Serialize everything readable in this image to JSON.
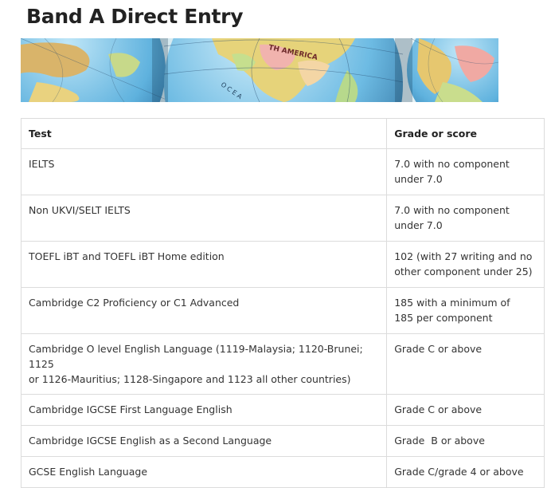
{
  "page": {
    "title": "Band A Direct Entry",
    "banner_label": "TH AMERICA",
    "banner_ocean_label": "O C E A"
  },
  "table": {
    "headers": {
      "test": "Test",
      "grade": "Grade or score"
    },
    "rows": [
      {
        "test": "IELTS",
        "grade": "7.0 with no component\nunder 7.0"
      },
      {
        "test": "Non UKVI/SELT IELTS",
        "grade": "7.0 with no component\nunder 7.0"
      },
      {
        "test": "TOEFL iBT and TOEFL iBT Home edition",
        "grade": "102 (with 27 writing and no\nother component under 25)"
      },
      {
        "test": "Cambridge C2 Proficiency or C1 Advanced",
        "grade": "185 with a minimum of\n185 per component"
      },
      {
        "test": "Cambridge O level English Language (1119-Malaysia; 1120-Brunei; 1125\nor 1126-Mauritius; 1128-Singapore and 1123 all other countries)",
        "grade": "Grade C or above"
      },
      {
        "test": "Cambridge IGCSE First Language English",
        "grade": "Grade C or above"
      },
      {
        "test": "Cambridge IGCSE English as a Second Language",
        "grade": "Grade  B or above"
      },
      {
        "test": "GCSE English Language",
        "grade": "Grade C/grade 4 or above"
      }
    ]
  }
}
